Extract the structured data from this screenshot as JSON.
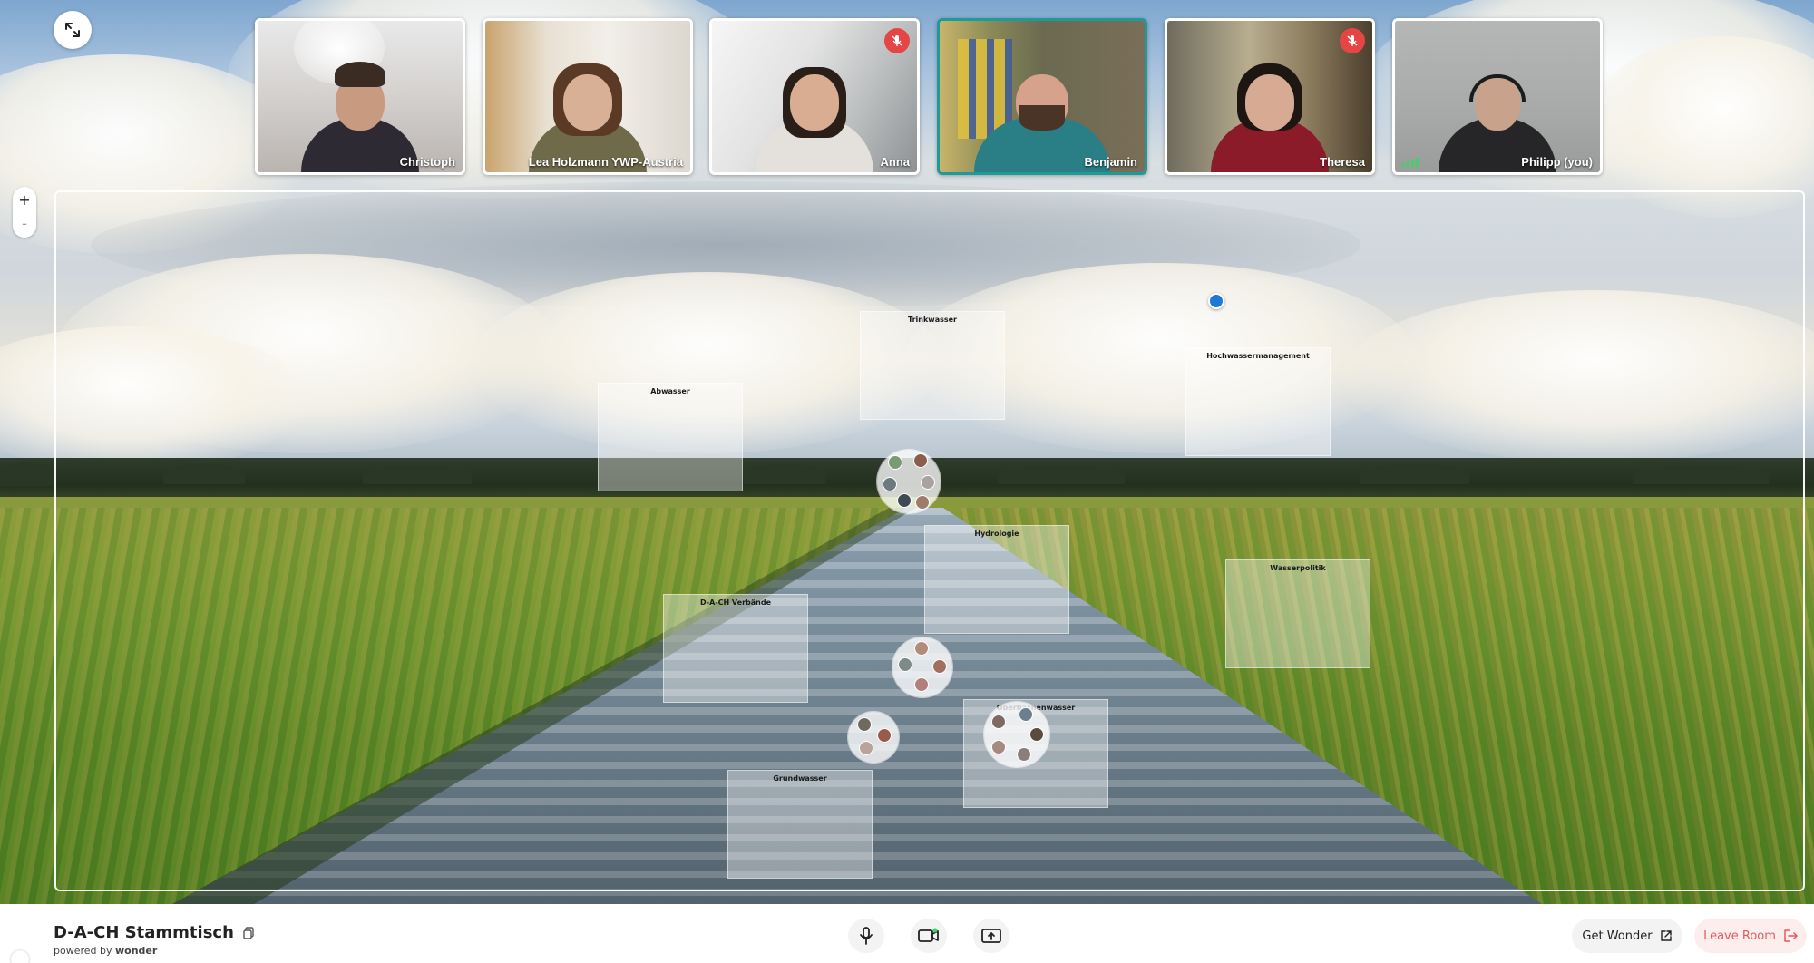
{
  "participants": [
    {
      "name": "Christoph",
      "muted": false
    },
    {
      "name": "Lea Holzmann YWP-Austria",
      "muted": false
    },
    {
      "name": "Anna",
      "muted": true
    },
    {
      "name": "Benjamin",
      "muted": false,
      "speaking": true
    },
    {
      "name": "Theresa",
      "muted": true
    },
    {
      "name": "Philipp (you)",
      "muted": false
    }
  ],
  "areas": [
    {
      "label": "Trinkwasser"
    },
    {
      "label": "Abwasser"
    },
    {
      "label": "Hochwassermanagement"
    },
    {
      "label": "Hydrologie"
    },
    {
      "label": "Wasserpolitik"
    },
    {
      "label": "D-A-CH Verbände"
    },
    {
      "label": "Oberflächenwasser"
    },
    {
      "label": "Grundwasser"
    }
  ],
  "zoom": {
    "in": "+",
    "out": "-"
  },
  "room": {
    "title": "D-A-CH Stammtisch",
    "powered_prefix": "powered by",
    "powered_brand": "wonder"
  },
  "buttons": {
    "get_wonder": "Get Wonder",
    "leave_room": "Leave Room"
  },
  "icons": {
    "fullscreen": "expand-icon",
    "mic": "microphone-icon",
    "camera": "camera-icon",
    "share": "screen-share-icon",
    "external": "external-link-icon",
    "leave": "exit-icon",
    "copy": "copy-icon",
    "muted": "mic-off-icon"
  },
  "colors": {
    "active_border": "#1f9a9a",
    "muted_badge": "#e64545",
    "user_dot": "#1e78d6",
    "leave_text": "#e35a5a"
  }
}
